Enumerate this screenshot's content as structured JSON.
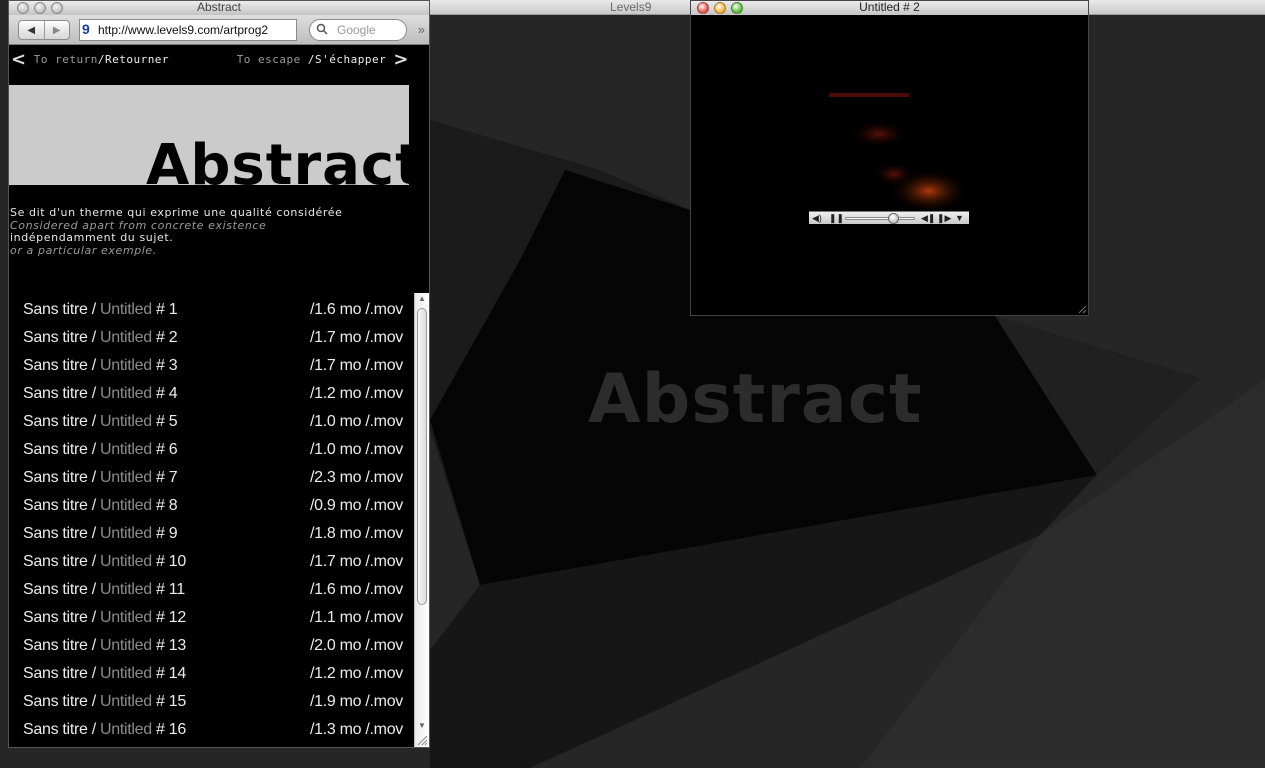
{
  "desktop": {
    "background_title": "Levels9",
    "watermark": "Abstract"
  },
  "browser": {
    "title": "Abstract",
    "url": "http://www.levels9.com/artprog2",
    "search_placeholder": "Google",
    "nav": {
      "back_arrow": "<",
      "back_en": "To return",
      "back_sep": "/",
      "back_fr": "Retourner",
      "escape_en": "To escape",
      "escape_sep": "/",
      "escape_fr": "S'échapper",
      "escape_arrow": ">"
    },
    "banner_title": "Abstract",
    "description": [
      {
        "lang": "fr",
        "text": "Se dit d'un therme qui exprime une qualité considérée"
      },
      {
        "lang": "en",
        "text": "Considered apart from concrete existence"
      },
      {
        "lang": "fr",
        "text": "indépendamment du sujet."
      },
      {
        "lang": "en",
        "text": "or a particular exemple."
      }
    ],
    "files": [
      {
        "fr": "Sans titre",
        "sep": " / ",
        "en": "Untitled",
        "num": " # 1",
        "size": "/1.6 mo /.mov"
      },
      {
        "fr": "Sans titre",
        "sep": " / ",
        "en": "Untitled",
        "num": " # 2",
        "size": "/1.7 mo /.mov"
      },
      {
        "fr": "Sans titre",
        "sep": " / ",
        "en": "Untitled",
        "num": " # 3",
        "size": "/1.7 mo /.mov"
      },
      {
        "fr": "Sans titre",
        "sep": " / ",
        "en": "Untitled",
        "num": " # 4",
        "size": "/1.2 mo /.mov"
      },
      {
        "fr": "Sans titre",
        "sep": " / ",
        "en": "Untitled",
        "num": " # 5",
        "size": "/1.0 mo /.mov"
      },
      {
        "fr": "Sans titre",
        "sep": " / ",
        "en": "Untitled",
        "num": " # 6",
        "size": "/1.0 mo /.mov"
      },
      {
        "fr": "Sans titre",
        "sep": " / ",
        "en": "Untitled",
        "num": " # 7",
        "size": "/2.3 mo /.mov"
      },
      {
        "fr": "Sans titre",
        "sep": " / ",
        "en": "Untitled",
        "num": " # 8",
        "size": "/0.9 mo /.mov"
      },
      {
        "fr": "Sans titre",
        "sep": " / ",
        "en": "Untitled",
        "num": " # 9",
        "size": "/1.8 mo /.mov"
      },
      {
        "fr": "Sans titre",
        "sep": " / ",
        "en": "Untitled",
        "num": " # 10",
        "size": "/1.7 mo /.mov"
      },
      {
        "fr": "Sans titre",
        "sep": " / ",
        "en": "Untitled",
        "num": " # 11",
        "size": "/1.6 mo /.mov"
      },
      {
        "fr": "Sans titre",
        "sep": " / ",
        "en": "Untitled",
        "num": " # 12",
        "size": "/1.1 mo /.mov"
      },
      {
        "fr": "Sans titre",
        "sep": " / ",
        "en": "Untitled",
        "num": " # 13",
        "size": "/2.0 mo /.mov"
      },
      {
        "fr": "Sans titre",
        "sep": " / ",
        "en": "Untitled",
        "num": " # 14",
        "size": "/1.2 mo /.mov"
      },
      {
        "fr": "Sans titre",
        "sep": " / ",
        "en": "Untitled",
        "num": " # 15",
        "size": "/1.9 mo /.mov"
      },
      {
        "fr": "Sans titre",
        "sep": " / ",
        "en": "Untitled",
        "num": " # 16",
        "size": "/1.3 mo /.mov"
      }
    ]
  },
  "player": {
    "title": "Untitled # 2",
    "volume_icon": "speaker-icon",
    "pause_icon": "pause-icon",
    "playhead_fraction": 0.68,
    "light_colors": [
      "#ec5b52",
      "#f5b73c",
      "#5fc13e"
    ]
  },
  "colors": {
    "desktop": "#262626",
    "page_bg": "#000000",
    "banner_bg": "#cbcbcb",
    "untitled_gray": "#8c8c8c"
  }
}
